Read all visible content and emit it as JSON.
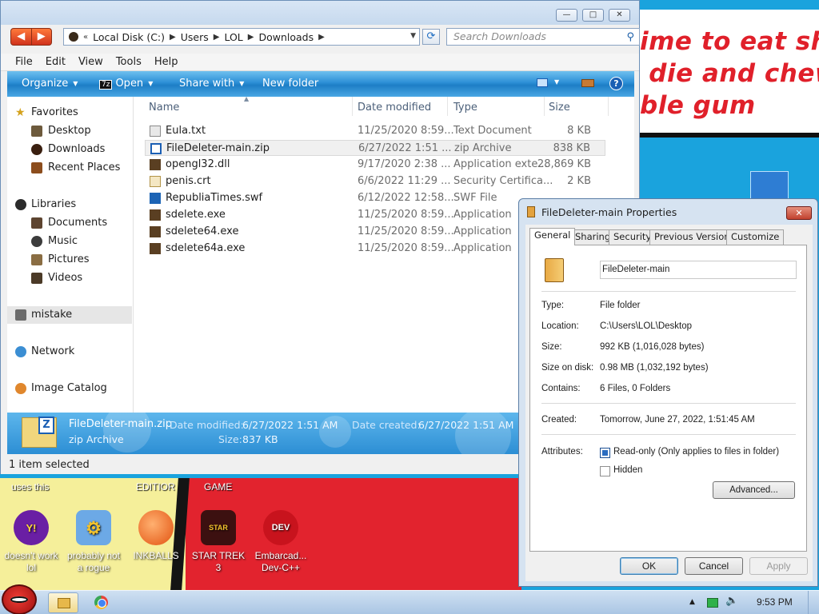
{
  "wallpaper": {
    "banner_text": "ime to eat shit\n die and chew\nble gum",
    "captions": [
      "uses this",
      "EDITIOR",
      "GAME"
    ]
  },
  "desktop_icons": [
    {
      "label": "doesn't work lol",
      "icon": "yahoo-messenger-icon"
    },
    {
      "label": "probably not a rogue",
      "icon": "system-gears-icon"
    },
    {
      "label": "INKBALLS",
      "icon": "inkball-icon"
    },
    {
      "label": "STAR TREK 3",
      "icon": "star-wars-icon"
    },
    {
      "label": "Embarcad... Dev-C++",
      "icon": "dev-cpp-icon"
    }
  ],
  "explorer": {
    "window_buttons": {
      "minimize": "—",
      "maximize": "□",
      "close": "✕"
    },
    "address": {
      "drive": "Local Disk (C:)",
      "path": [
        "Users",
        "LOL",
        "Downloads"
      ],
      "chevron": "«"
    },
    "search_placeholder": "Search Downloads",
    "menu": [
      "File",
      "Edit",
      "View",
      "Tools",
      "Help"
    ],
    "commands": {
      "organize": "Organize",
      "open": "Open",
      "share": "Share with",
      "new_folder": "New folder",
      "help": "?"
    },
    "nav": {
      "favorites": "Favorites",
      "favorites_items": [
        "Desktop",
        "Downloads",
        "Recent Places"
      ],
      "libraries": "Libraries",
      "libraries_items": [
        "Documents",
        "Music",
        "Pictures",
        "Videos"
      ],
      "mistake": "mistake",
      "network": "Network",
      "image_catalog": "Image Catalog"
    },
    "columns": {
      "name": "Name",
      "date": "Date modified",
      "type": "Type",
      "size": "Size"
    },
    "files": [
      {
        "name": "Eula.txt",
        "date": "11/25/2020 8:59...",
        "type": "Text Document",
        "size": "8 KB",
        "icon": "text-file-icon"
      },
      {
        "name": "FileDeleter-main.zip",
        "date": "6/27/2022 1:51 ...",
        "type": "zip Archive",
        "size": "838 KB",
        "icon": "zip-file-icon",
        "selected": true
      },
      {
        "name": "opengl32.dll",
        "date": "9/17/2020 2:38 ...",
        "type": "Application exte...",
        "size": "28,869 KB",
        "icon": "dll-file-icon"
      },
      {
        "name": "penis.crt",
        "date": "6/6/2022 11:29 ...",
        "type": "Security Certifica...",
        "size": "2 KB",
        "icon": "certificate-file-icon"
      },
      {
        "name": "RepubliaTimes.swf",
        "date": "6/12/2022 12:58...",
        "type": "SWF File",
        "size": "",
        "icon": "swf-file-icon"
      },
      {
        "name": "sdelete.exe",
        "date": "11/25/2020 8:59...",
        "type": "Application",
        "size": "",
        "icon": "exe-file-icon"
      },
      {
        "name": "sdelete64.exe",
        "date": "11/25/2020 8:59...",
        "type": "Application",
        "size": "",
        "icon": "exe-file-icon"
      },
      {
        "name": "sdelete64a.exe",
        "date": "11/25/2020 8:59...",
        "type": "Application",
        "size": "",
        "icon": "exe-file-icon"
      }
    ],
    "details": {
      "name": "FileDeleter-main.zip",
      "kind": "zip Archive",
      "date_modified_label": "Date modified:",
      "date_modified": "6/27/2022 1:51 AM",
      "date_created_label": "Date created:",
      "date_created": "6/27/2022 1:51 AM",
      "size_label": "Size:",
      "size": "837 KB"
    },
    "status": "1 item selected"
  },
  "properties": {
    "title": "FileDeleter-main Properties",
    "tabs": [
      "General",
      "Sharing",
      "Security",
      "Previous Versions",
      "Customize"
    ],
    "name_value": "FileDeleter-main",
    "fields": [
      {
        "label": "Type:",
        "value": "File folder"
      },
      {
        "label": "Location:",
        "value": "C:\\Users\\LOL\\Desktop"
      },
      {
        "label": "Size:",
        "value": "992 KB (1,016,028 bytes)"
      },
      {
        "label": "Size on disk:",
        "value": "0.98 MB (1,032,192 bytes)"
      },
      {
        "label": "Contains:",
        "value": "6 Files, 0 Folders"
      }
    ],
    "created_label": "Created:",
    "created_value": "Tomorrow, June 27, 2022, 1:51:45 AM",
    "attributes_label": "Attributes:",
    "readonly_label": "Read-only (Only applies to files in folder)",
    "hidden_label": "Hidden",
    "advanced_label": "Advanced...",
    "ok": "OK",
    "cancel": "Cancel",
    "apply": "Apply"
  },
  "taskbar": {
    "clock": "9:53 PM",
    "tray_arrow": "▲"
  }
}
